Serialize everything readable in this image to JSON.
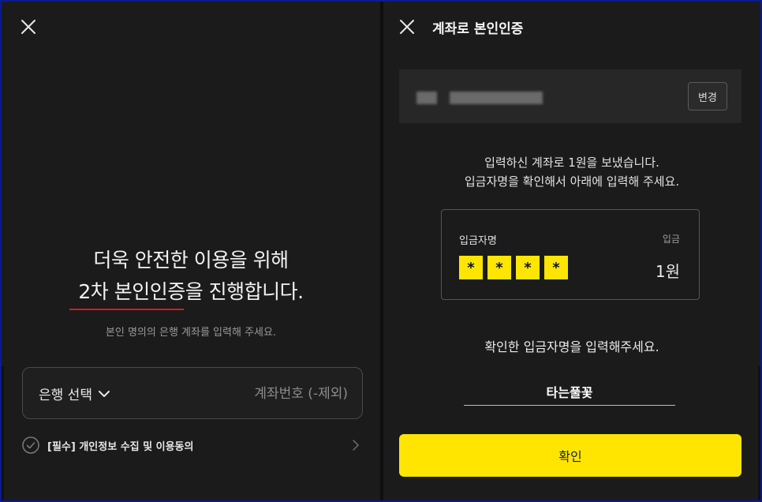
{
  "left": {
    "headline_line1": "더욱 안전한 이용을 위해",
    "headline_line2_underlined": "2차 본인인증",
    "headline_line2_rest": "을 진행합니다.",
    "subtitle": "본인 명의의 은행 계좌를 입력해 주세요.",
    "bank_select_label": "은행 선택",
    "account_placeholder": "계좌번호 (-제외)",
    "consent_label": "[필수] 개인정보 수집 및 이용동의"
  },
  "right": {
    "title": "계좌로 본인인증",
    "change_button": "변경",
    "message_line1": "입력하신 계좌로 1원을 보냈습니다.",
    "message_line2": "입금자명을 확인해서 아래에 입력해 주세요.",
    "deposit_card": {
      "depositor_label": "입금자명",
      "deposit_label": "입금",
      "masked_chars": [
        "*",
        "*",
        "*",
        "*"
      ],
      "amount": "1원"
    },
    "prompt": "확인한 입금자명을 입력해주세요.",
    "name_input_value": "타는풀꽃",
    "confirm_button": "확인"
  },
  "colors": {
    "accent_yellow": "#ffe500",
    "background": "#1b1b1b",
    "underline_red": "#e0171b",
    "frame_blue": "#0c1a8f"
  }
}
